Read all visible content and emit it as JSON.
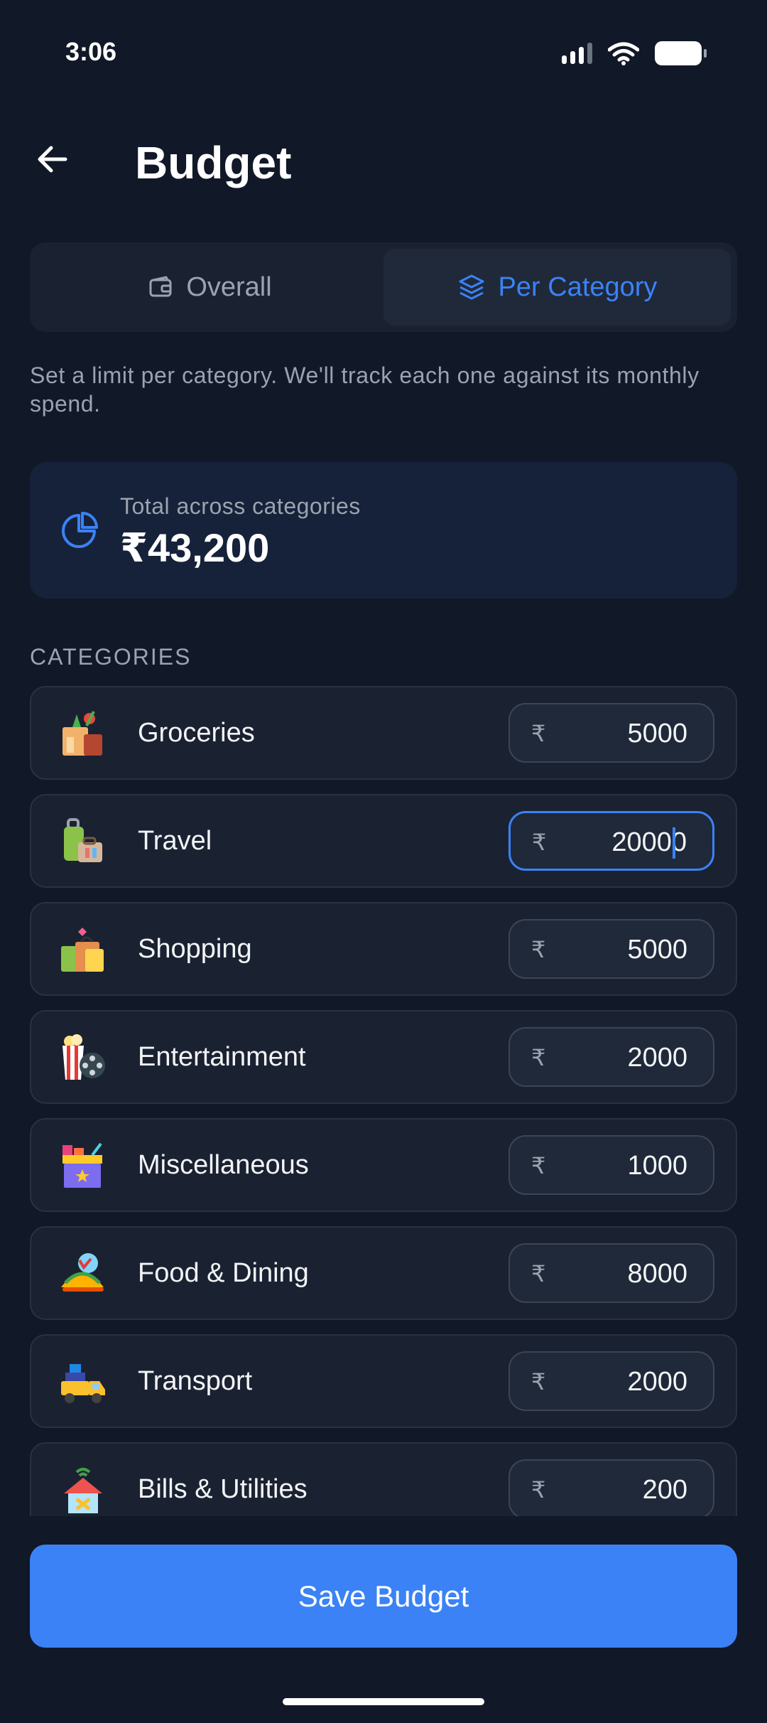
{
  "status_bar": {
    "time": "3:06"
  },
  "header": {
    "title": "Budget",
    "back_icon": "arrow-left-icon"
  },
  "tabs": [
    {
      "label": "Overall",
      "icon": "wallet-icon",
      "active": false
    },
    {
      "label": "Per Category",
      "icon": "layers-icon",
      "active": true
    }
  ],
  "helper_text": "Set a limit per category. We'll track each one against its monthly spend.",
  "total": {
    "label": "Total across categories",
    "value": "₹43,200",
    "icon": "pie-chart-icon"
  },
  "section_label": "CATEGORIES",
  "currency_symbol": "₹",
  "categories": [
    {
      "name": "Groceries",
      "amount": "5000",
      "icon": "grocery-bag-icon"
    },
    {
      "name": "Travel",
      "amount": "20000",
      "icon": "luggage-icon",
      "focused": true
    },
    {
      "name": "Shopping",
      "amount": "5000",
      "icon": "shopping-bags-icon"
    },
    {
      "name": "Entertainment",
      "amount": "2000",
      "icon": "popcorn-film-icon"
    },
    {
      "name": "Miscellaneous",
      "amount": "1000",
      "icon": "box-icon"
    },
    {
      "name": "Food & Dining",
      "amount": "8000",
      "icon": "taco-icon"
    },
    {
      "name": "Transport",
      "amount": "2000",
      "icon": "truck-icon"
    },
    {
      "name": "Bills & Utilities",
      "amount": "200",
      "icon": "house-wifi-icon"
    }
  ],
  "save_button": {
    "label": "Save Budget"
  },
  "colors": {
    "accent": "#3b82f6",
    "background": "#111827",
    "card": "#1a2232"
  }
}
